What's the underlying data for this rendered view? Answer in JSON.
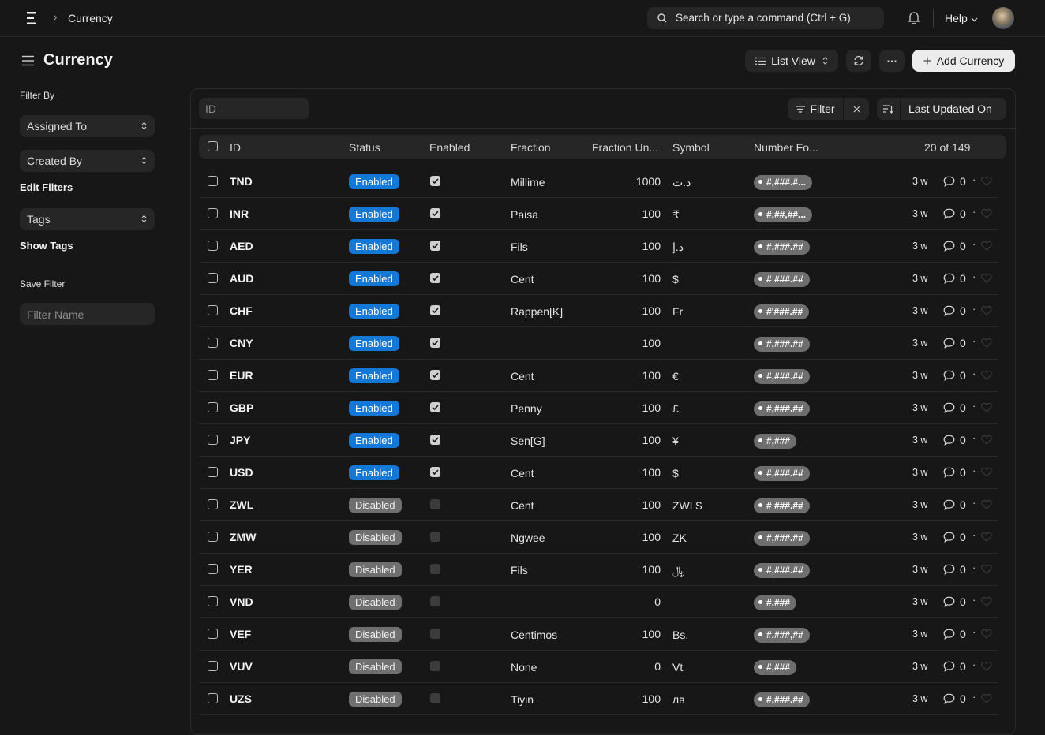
{
  "breadcrumb": {
    "current": "Currency"
  },
  "search": {
    "placeholder": "Search or type a command (Ctrl + G)"
  },
  "header": {
    "help_label": "Help"
  },
  "page": {
    "title": "Currency"
  },
  "toolbar": {
    "view_label": "List View",
    "add_label": "Add Currency"
  },
  "sidebar": {
    "filter_by_label": "Filter By",
    "assigned_to": "Assigned To",
    "created_by": "Created By",
    "edit_filters": "Edit Filters",
    "tags": "Tags",
    "show_tags": "Show Tags",
    "save_filter_label": "Save Filter",
    "filter_name_placeholder": "Filter Name"
  },
  "list": {
    "id_filter_placeholder": "ID",
    "filter_label": "Filter",
    "sort_label": "Last Updated On",
    "columns": {
      "id": "ID",
      "status": "Status",
      "enabled": "Enabled",
      "fraction": "Fraction",
      "fraction_units": "Fraction Un...",
      "symbol": "Symbol",
      "number_format": "Number Fo..."
    },
    "count": "20 of 149",
    "rows": [
      {
        "id": "TND",
        "status": "Enabled",
        "enabled": true,
        "fraction": "Millime",
        "units": "1000",
        "symbol": "د.ت",
        "format": "#,###.#...",
        "ago": "3 w",
        "comments": "0"
      },
      {
        "id": "INR",
        "status": "Enabled",
        "enabled": true,
        "fraction": "Paisa",
        "units": "100",
        "symbol": "₹",
        "format": "#,##,##...",
        "ago": "3 w",
        "comments": "0"
      },
      {
        "id": "AED",
        "status": "Enabled",
        "enabled": true,
        "fraction": "Fils",
        "units": "100",
        "symbol": "د.إ",
        "format": "#,###.##",
        "ago": "3 w",
        "comments": "0"
      },
      {
        "id": "AUD",
        "status": "Enabled",
        "enabled": true,
        "fraction": "Cent",
        "units": "100",
        "symbol": "$",
        "format": "# ###.##",
        "ago": "3 w",
        "comments": "0"
      },
      {
        "id": "CHF",
        "status": "Enabled",
        "enabled": true,
        "fraction": "Rappen[K]",
        "units": "100",
        "symbol": "Fr",
        "format": "#'###.##",
        "ago": "3 w",
        "comments": "0"
      },
      {
        "id": "CNY",
        "status": "Enabled",
        "enabled": true,
        "fraction": "",
        "units": "100",
        "symbol": "",
        "format": "#,###.##",
        "ago": "3 w",
        "comments": "0"
      },
      {
        "id": "EUR",
        "status": "Enabled",
        "enabled": true,
        "fraction": "Cent",
        "units": "100",
        "symbol": "€",
        "format": "#,###.##",
        "ago": "3 w",
        "comments": "0"
      },
      {
        "id": "GBP",
        "status": "Enabled",
        "enabled": true,
        "fraction": "Penny",
        "units": "100",
        "symbol": "£",
        "format": "#,###.##",
        "ago": "3 w",
        "comments": "0"
      },
      {
        "id": "JPY",
        "status": "Enabled",
        "enabled": true,
        "fraction": "Sen[G]",
        "units": "100",
        "symbol": "¥",
        "format": "#,###",
        "ago": "3 w",
        "comments": "0"
      },
      {
        "id": "USD",
        "status": "Enabled",
        "enabled": true,
        "fraction": "Cent",
        "units": "100",
        "symbol": "$",
        "format": "#,###.##",
        "ago": "3 w",
        "comments": "0"
      },
      {
        "id": "ZWL",
        "status": "Disabled",
        "enabled": false,
        "fraction": "Cent",
        "units": "100",
        "symbol": "ZWL$",
        "format": "# ###.##",
        "ago": "3 w",
        "comments": "0"
      },
      {
        "id": "ZMW",
        "status": "Disabled",
        "enabled": false,
        "fraction": "Ngwee",
        "units": "100",
        "symbol": "ZK",
        "format": "#,###.##",
        "ago": "3 w",
        "comments": "0"
      },
      {
        "id": "YER",
        "status": "Disabled",
        "enabled": false,
        "fraction": "Fils",
        "units": "100",
        "symbol": "﷼",
        "format": "#,###.##",
        "ago": "3 w",
        "comments": "0"
      },
      {
        "id": "VND",
        "status": "Disabled",
        "enabled": false,
        "fraction": "",
        "units": "0",
        "symbol": "",
        "format": "#.###",
        "ago": "3 w",
        "comments": "0"
      },
      {
        "id": "VEF",
        "status": "Disabled",
        "enabled": false,
        "fraction": "Centimos",
        "units": "100",
        "symbol": "Bs.",
        "format": "#.###,##",
        "ago": "3 w",
        "comments": "0"
      },
      {
        "id": "VUV",
        "status": "Disabled",
        "enabled": false,
        "fraction": "None",
        "units": "0",
        "symbol": "Vt",
        "format": "#,###",
        "ago": "3 w",
        "comments": "0"
      },
      {
        "id": "UZS",
        "status": "Disabled",
        "enabled": false,
        "fraction": "Tiyin",
        "units": "100",
        "symbol": "лв",
        "format": "#,###.##",
        "ago": "3 w",
        "comments": "0"
      }
    ]
  },
  "colors": {
    "enabled_badge": "#1378d6",
    "disabled_badge": "#6f6f6f",
    "background": "#171717",
    "surface": "#262626"
  }
}
